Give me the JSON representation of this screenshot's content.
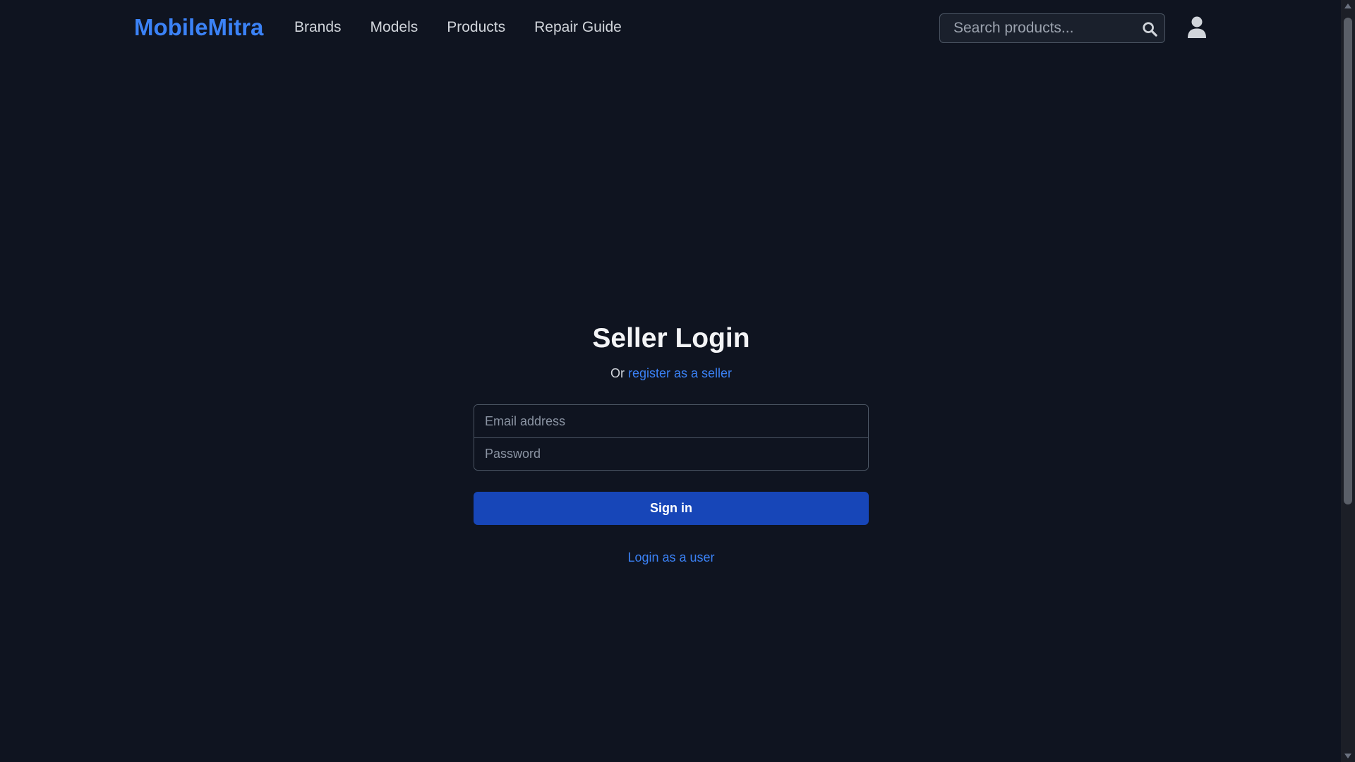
{
  "header": {
    "logo": "MobileMitra",
    "nav": [
      "Brands",
      "Models",
      "Products",
      "Repair Guide"
    ],
    "search": {
      "placeholder": "Search products...",
      "value": ""
    }
  },
  "login": {
    "title": "Seller Login",
    "subtitle_prefix": "Or",
    "register_link": "register as a seller",
    "email_placeholder": "Email address",
    "password_placeholder": "Password",
    "signin_label": "Sign in",
    "user_login_link": "Login as a user"
  },
  "colors": {
    "background": "#0f1420",
    "accent": "#3b82f6",
    "button": "#1746b8"
  },
  "icons": {
    "search": "search-icon",
    "user": "user-icon"
  }
}
